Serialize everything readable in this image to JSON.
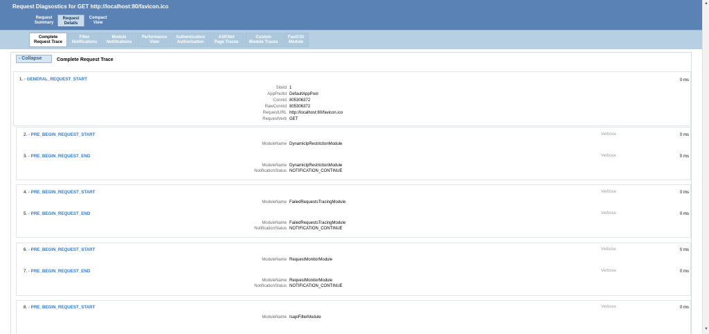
{
  "header": {
    "title": "Request Diagsostics for GET http://localhost:80/favicon.ico"
  },
  "top_tabs": [
    "Request\nSummary",
    "Request\nDetails",
    "Compact\nView"
  ],
  "sub_tabs": [
    "Complete\nRequest Trace",
    "Filter\nNotifications",
    "Module\nNotifications",
    "Performance\nView",
    "Authentication\nAuthorization",
    "ASP.Net\nPage Traces",
    "Custom\nModule Traces",
    "FastCGI\nModule"
  ],
  "trace": {
    "collapse": "- Collapse",
    "title": "Complete Request Trace"
  },
  "events": [
    {
      "num": "1.",
      "name": "- GENERAL_REQUEST_START",
      "ms": "0 ms",
      "level": "",
      "fields": [
        {
          "k": "SiteId",
          "v": "1"
        },
        {
          "k": "AppPoolId",
          "v": "DefaultAppPool"
        },
        {
          "k": "ConnId",
          "v": "805306372"
        },
        {
          "k": "RawConnId",
          "v": "805306372"
        },
        {
          "k": "RequestURL",
          "v": "http://localhost:80/favicon.ico"
        },
        {
          "k": "RequestVerb",
          "v": "GET"
        }
      ]
    },
    {
      "num": "2.",
      "name": "- PRE_BEGIN_REQUEST_START",
      "ms": "0 ms",
      "level": "Verbose",
      "fields": [
        {
          "k": "ModuleName",
          "v": "DynamicIpRestrictionModule"
        }
      ]
    },
    {
      "num": "3.",
      "name": "- PRE_BEGIN_REQUEST_END",
      "ms": "0 ms",
      "level": "Verbose",
      "fields": [
        {
          "k": "ModuleName",
          "v": "DynamicIpRestrictionModule"
        },
        {
          "k": "NotificationStatus",
          "v": "NOTIFICATION_CONTINUE"
        }
      ]
    },
    {
      "num": "4.",
      "name": "- PRE_BEGIN_REQUEST_START",
      "ms": "0 ms",
      "level": "Verbose",
      "fields": [
        {
          "k": "ModuleName",
          "v": "FailedRequestsTracingModule"
        }
      ]
    },
    {
      "num": "5.",
      "name": "- PRE_BEGIN_REQUEST_END",
      "ms": "0 ms",
      "level": "Verbose",
      "fields": [
        {
          "k": "ModuleName",
          "v": "FailedRequestsTracingModule"
        },
        {
          "k": "NotificationStatus",
          "v": "NOTIFICATION_CONTINUE"
        }
      ]
    },
    {
      "num": "6.",
      "name": "- PRE_BEGIN_REQUEST_START",
      "ms": "0 ms",
      "level": "Verbose",
      "fields": [
        {
          "k": "ModuleName",
          "v": "RequestMonitorModule"
        }
      ]
    },
    {
      "num": "7.",
      "name": "- PRE_BEGIN_REQUEST_END",
      "ms": "0 ms",
      "level": "Verbose",
      "fields": [
        {
          "k": "ModuleName",
          "v": "RequestMonitorModule"
        },
        {
          "k": "NotificationStatus",
          "v": "NOTIFICATION_CONTINUE"
        }
      ]
    },
    {
      "num": "8.",
      "name": "- PRE_BEGIN_REQUEST_START",
      "ms": "0 ms",
      "level": "Verbose",
      "fields": [
        {
          "k": "ModuleName",
          "v": "IsapiFilterModule"
        }
      ]
    }
  ]
}
